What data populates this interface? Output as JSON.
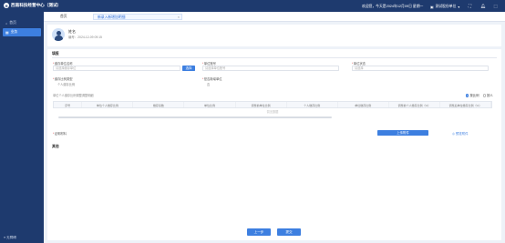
{
  "header": {
    "app_title": "西南科技经营中心（测试）",
    "greeting": "欢迎您，今天是2024年12月09日 星期一",
    "org": "测试股份单位",
    "org_arrow": "▾",
    "icons": [
      "fullscreen-icon",
      "bell-icon",
      "user-menu-icon"
    ]
  },
  "sidebar": {
    "items": [
      {
        "label": "首页",
        "icon": "home-icon"
      },
      {
        "label": "业务",
        "icon": "grid-icon",
        "active": true
      }
    ],
    "footer": "无障碍"
  },
  "tabs": {
    "home": "首页",
    "current": "新录入新增加明细",
    "close": "×"
  },
  "profile": {
    "name": "姓名",
    "meta": "编号：2024-12-09 09:15"
  },
  "form": {
    "section1": "填报",
    "field_unit_label": "缴存单位名称",
    "field_unit_value": "请选择缴存单位",
    "field_unit_button": "选择",
    "field_account_label": "单位账号",
    "field_account_value": "请选择单位账号",
    "field_status_label": "单位状态",
    "field_status_value": "请选择",
    "field_type_label": "缴存比例类型",
    "field_type_value": "个人缴存比例",
    "field_flag_label": "是否新增单位",
    "field_flag_value": "否",
    "table_title": "单位个人缴存比例调整调整明细",
    "radio_options": [
      "按比例",
      "按人"
    ],
    "table_headers": [
      "序号",
      "单位个人缴存比例",
      "缴存基数",
      "单位比例",
      "调整前单位比例",
      "个人缴存比例",
      "单位缴存比例",
      "调整前个人缴存比例（%）",
      "调整后单位缴存比例（%）"
    ],
    "empty_text": "暂无数据",
    "attach_label": "证明材料",
    "upload_button": "上传附件",
    "preview_link": "预览附件",
    "section2": "其他"
  },
  "footer": {
    "prev_button": "上一步",
    "submit_button": "提交"
  }
}
